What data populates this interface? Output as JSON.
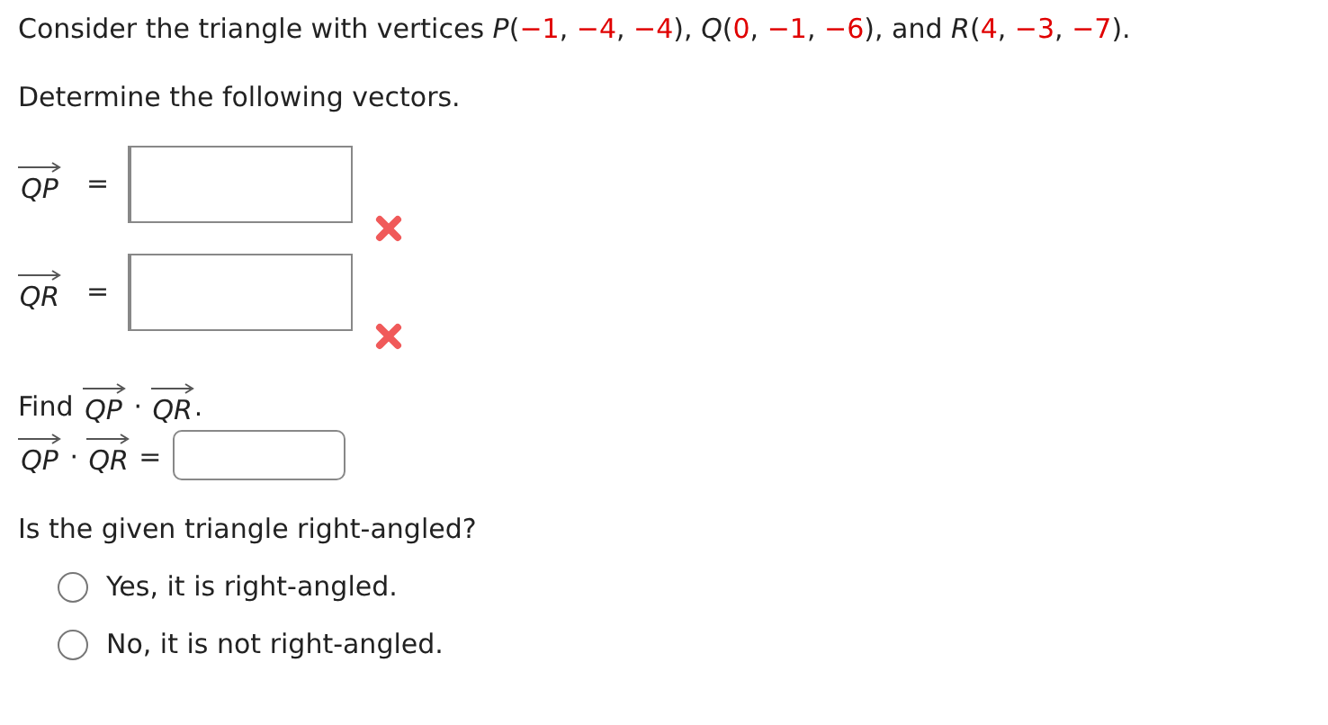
{
  "intro": [
    {
      "kind": "text",
      "text": "Consider the triangle with vertices "
    },
    {
      "kind": "point",
      "text": "P"
    },
    {
      "kind": "text",
      "text": "("
    },
    {
      "kind": "number",
      "text": "−1"
    },
    {
      "kind": "text",
      "text": ", "
    },
    {
      "kind": "number",
      "text": "−4"
    },
    {
      "kind": "text",
      "text": ", "
    },
    {
      "kind": "number",
      "text": "−4"
    },
    {
      "kind": "text",
      "text": "), "
    },
    {
      "kind": "point",
      "text": "Q"
    },
    {
      "kind": "text",
      "text": "("
    },
    {
      "kind": "number",
      "text": "0"
    },
    {
      "kind": "text",
      "text": ", "
    },
    {
      "kind": "number",
      "text": "−1"
    },
    {
      "kind": "text",
      "text": ", "
    },
    {
      "kind": "number",
      "text": "−6"
    },
    {
      "kind": "text",
      "text": "), and "
    },
    {
      "kind": "point",
      "text": "R"
    },
    {
      "kind": "text",
      "text": "("
    },
    {
      "kind": "number",
      "text": "4"
    },
    {
      "kind": "text",
      "text": ", "
    },
    {
      "kind": "number",
      "text": "−3"
    },
    {
      "kind": "text",
      "text": ", "
    },
    {
      "kind": "number",
      "text": "−7"
    },
    {
      "kind": "text",
      "text": ")."
    }
  ],
  "instruction": "Determine the following vectors.",
  "vector_answers": [
    {
      "vector": "QP",
      "equals": "=",
      "incorrect": true
    },
    {
      "vector": "QR",
      "equals": "=",
      "incorrect": true
    }
  ],
  "dot_product": {
    "prompt": [
      {
        "kind": "text",
        "text": "Find "
      },
      {
        "kind": "vector",
        "text": "QP"
      },
      {
        "kind": "text",
        "text": " · "
      },
      {
        "kind": "vector",
        "text": "QR"
      },
      {
        "kind": "text",
        "text": "."
      }
    ],
    "lhs": [
      {
        "kind": "vector",
        "text": "QP"
      },
      {
        "kind": "text",
        "text": " · "
      },
      {
        "kind": "vector",
        "text": "QR"
      },
      {
        "kind": "text",
        "text": " ="
      }
    ]
  },
  "question": {
    "prompt": "Is the given triangle right-angled?",
    "options": [
      {
        "label": "Yes, it is right-angled.",
        "selected": false
      },
      {
        "label": "No, it is not right-angled.",
        "selected": false
      }
    ]
  }
}
